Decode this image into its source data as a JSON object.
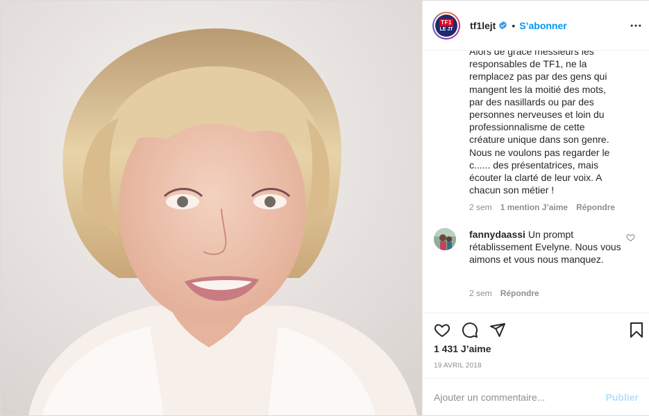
{
  "post": {
    "username": "tf1lejt",
    "follow_label": "S’abonner",
    "separator": "•",
    "avatar_line1": "TF1",
    "avatar_line2": "LE JT",
    "icons": {
      "more": "more-options-icon",
      "verified": "verified-badge-icon",
      "like": "heart-icon",
      "comment": "comment-icon",
      "share": "paper-plane-icon",
      "save": "bookmark-icon"
    }
  },
  "caption": {
    "text": "Alors de grâce messieurs les\nresponsables de TF1, ne la\nremplacez pas par des gens qui\nmangent les la moitié des mots,\npar des nasillards ou par des\npersonnes nerveuses et loin du\nprofessionnalisme de cette\ncréature unique dans son genre.\nNous ne voulons pas regarder le\nc...... des présentatrices, mais\nécouter la clarté de leur voix. A\nchacun son métier !",
    "time": "2 sem",
    "likes": "1 mention J’aime",
    "reply": "Répondre"
  },
  "comment": {
    "username": "fannydaassi",
    "text": "Un prompt rétablissement Evelyne. Nous vous aimons et vous nous manquez.",
    "time": "2 sem",
    "reply": "Répondre"
  },
  "stats": {
    "likes": "1 431 J’aime",
    "date": "19 AVRIL 2018"
  },
  "add_comment": {
    "placeholder": "Ajouter un commentaire...",
    "post_label": "Publier"
  },
  "colors": {
    "link_blue": "#0095f6",
    "muted": "#8e8e8e",
    "post_disabled": "#b2dffc"
  }
}
